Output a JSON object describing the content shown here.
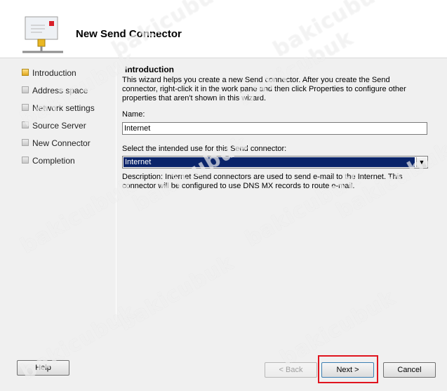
{
  "header": {
    "title": "New Send Connector"
  },
  "steps": [
    {
      "label": "Introduction",
      "active": true
    },
    {
      "label": "Address space",
      "active": false
    },
    {
      "label": "Network settings",
      "active": false
    },
    {
      "label": "Source Server",
      "active": false
    },
    {
      "label": "New Connector",
      "active": false
    },
    {
      "label": "Completion",
      "active": false
    }
  ],
  "content": {
    "title": "Introduction",
    "description": "This wizard helps you create a new Send connector. After you create the Send connector, right-click it in the work pane and then click Properties to configure other properties that aren't shown in this wizard.",
    "name_label": "Name:",
    "name_value": "Internet",
    "use_label": "Select the intended use for this Send connector:",
    "use_value": "Internet",
    "use_description": "Description: Internet Send connectors are used to send e-mail to the Internet. This connector will be configured to use DNS MX records to route e-mail."
  },
  "buttons": {
    "help": "Help",
    "back": "< Back",
    "next": "Next >",
    "cancel": "Cancel"
  },
  "watermark": "bakicubuk",
  "colors": {
    "selection": "#0a246a",
    "highlight": "#e0141e",
    "active_step": "#e2a81e"
  }
}
